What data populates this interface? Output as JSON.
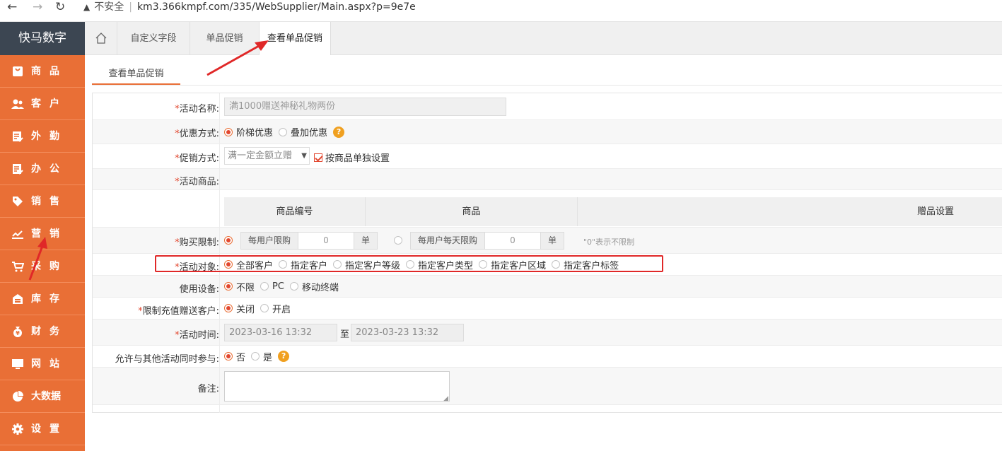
{
  "browser": {
    "insecure_label": "不安全",
    "url": "km3.366kmpf.com/335/WebSupplier/Main.aspx?p=9e7e"
  },
  "sidebar": {
    "brand": "快马数字",
    "items": [
      {
        "label": "商品",
        "icon": "bag-icon"
      },
      {
        "label": "客户",
        "icon": "users-icon"
      },
      {
        "label": "外勤",
        "icon": "clipboard-icon"
      },
      {
        "label": "办公",
        "icon": "clipboard-icon"
      },
      {
        "label": "销售",
        "icon": "tag-icon"
      },
      {
        "label": "营销",
        "icon": "chart-icon"
      },
      {
        "label": "采购",
        "icon": "cart-icon"
      },
      {
        "label": "库存",
        "icon": "warehouse-icon"
      },
      {
        "label": "财务",
        "icon": "money-bag-icon"
      },
      {
        "label": "网站",
        "icon": "monitor-icon"
      },
      {
        "label": "大数据",
        "icon": "pie-icon"
      },
      {
        "label": "设置",
        "icon": "gear-icon"
      }
    ]
  },
  "tabs": [
    "自定义字段",
    "单品促销",
    "查看单品促销"
  ],
  "subtab": "查看单品促销",
  "form": {
    "activity_name": {
      "label": "活动名称:",
      "value": "满1000赠送神秘礼物两份"
    },
    "discount_method": {
      "label": "优惠方式:",
      "options": [
        "阶梯优惠",
        "叠加优惠"
      ]
    },
    "promo_method": {
      "label": "促销方式:",
      "select": "满一定金额立赠",
      "checkbox_label": "按商品单独设置"
    },
    "activity_goods": {
      "label": "活动商品:"
    },
    "goods_table": {
      "headers": [
        "商品编号",
        "商品",
        "赠品设置"
      ]
    },
    "purchase_limit": {
      "label": "购买限制:",
      "per_user_label": "每用户限购",
      "per_user_value": "0",
      "unit": "单",
      "per_day_label": "每用户每天限购",
      "per_day_value": "0",
      "note": "\"0\"表示不限制"
    },
    "target": {
      "label": "活动对象:",
      "options": [
        "全部客户",
        "指定客户",
        "指定客户等级",
        "指定客户类型",
        "指定客户区域",
        "指定客户标签"
      ]
    },
    "device": {
      "label": "使用设备:",
      "options": [
        "不限",
        "PC",
        "移动终端"
      ]
    },
    "recharge": {
      "label": "限制充值赠送客户:",
      "options": [
        "关闭",
        "开启"
      ]
    },
    "time": {
      "label": "活动时间:",
      "start": "2023-03-16 13:32",
      "to": "至",
      "end": "2023-03-23 13:32"
    },
    "allow_other": {
      "label": "允许与其他活动同时参与:",
      "options": [
        "否",
        "是"
      ]
    },
    "remark": {
      "label": "备注:"
    }
  },
  "colors": {
    "accent": "#e96f36",
    "sidebar_brand_bg": "#3c4652",
    "highlight": "#e02828"
  }
}
